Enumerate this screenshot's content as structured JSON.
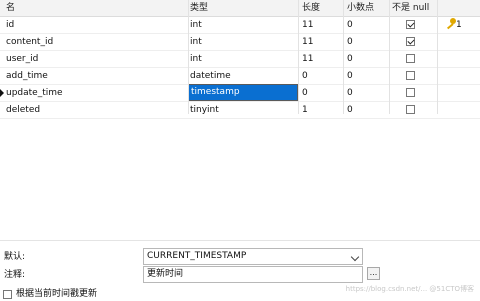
{
  "headers": {
    "name": "名",
    "type": "类型",
    "length": "长度",
    "decimals": "小数点",
    "not_null": "不是 null"
  },
  "rows": [
    {
      "name": "id",
      "type": "int",
      "length": "11",
      "decimals": "0",
      "not_null": true,
      "key": "1"
    },
    {
      "name": "content_id",
      "type": "int",
      "length": "11",
      "decimals": "0",
      "not_null": true
    },
    {
      "name": "user_id",
      "type": "int",
      "length": "11",
      "decimals": "0",
      "not_null": false
    },
    {
      "name": "add_time",
      "type": "datetime",
      "length": "0",
      "decimals": "0",
      "not_null": false
    },
    {
      "name": "update_time",
      "type": "timestamp",
      "length": "0",
      "decimals": "0",
      "not_null": false,
      "selected": true
    },
    {
      "name": "deleted",
      "type": "tinyint",
      "length": "1",
      "decimals": "0",
      "not_null": false
    }
  ],
  "key_icon": "key-icon",
  "colors": {
    "selection": "#0a6fd1",
    "key": "#e0a800"
  },
  "properties": {
    "default_label": "默认:",
    "default_value": "CURRENT_TIMESTAMP",
    "comment_label": "注释:",
    "comment_value": "更新时间",
    "browse_label": "...",
    "update_on_current_label": "根据当前时间戳更新",
    "update_on_current_checked": false
  },
  "watermark": "https://blog.csdn.net/... @51CTO博客"
}
